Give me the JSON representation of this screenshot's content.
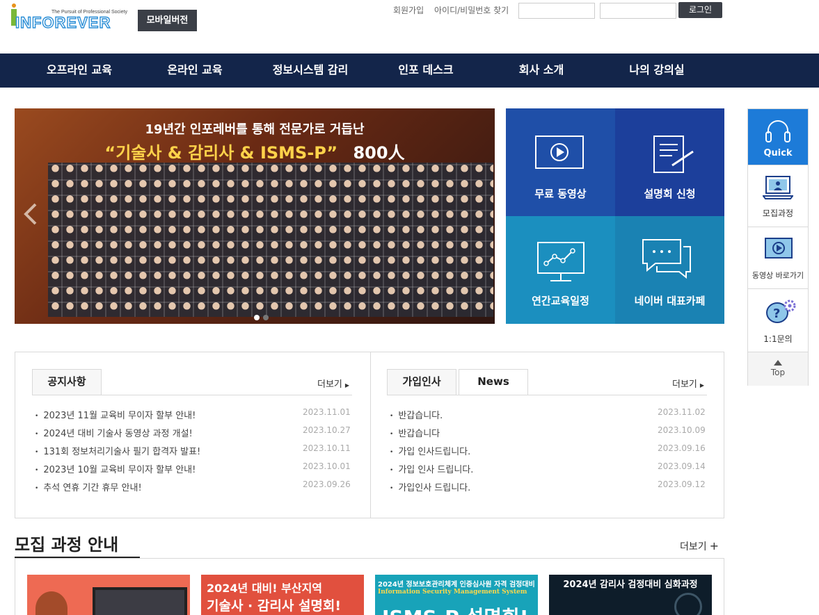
{
  "header": {
    "logo_tagline": "The Pursuit of Professional Society",
    "logo_word": "INFOREVER",
    "mobile_label": "모바일버전",
    "signup_label": "회원가입",
    "find_label": "아이디/비밀번호 찾기",
    "login_label": "로그인"
  },
  "nav": {
    "items": [
      "오프라인 교육",
      "온라인 교육",
      "정보시스템 감리",
      "인포 데스크",
      "회사 소개",
      "나의 강의실"
    ]
  },
  "hero": {
    "line1": "19년간 인포레버를 통해 전문가로 거듭난",
    "line2_quote": "“기술사 & 감리사 & ISMS-P”",
    "line2_count": "800人",
    "prev_icon": "chevron-left-icon"
  },
  "tiles": {
    "free_video": "무료 동영상",
    "seminar": "설명회 신청",
    "schedule": "연간교육일정",
    "naver_cafe": "네이버 대표카페"
  },
  "quick": {
    "title": "Quick",
    "courses": "모집과정",
    "video": "동영상 바로가기",
    "inquiry": "1:1문의",
    "top": "Top"
  },
  "notice": {
    "tab": "공지사항",
    "more": "더보기",
    "posts": [
      {
        "title": "2023년 11월 교육비 무이자 할부 안내!",
        "date": "2023.11.01"
      },
      {
        "title": "2024년 대비 기술사 동영상 과정 개설!",
        "date": "2023.10.27"
      },
      {
        "title": "131회 정보처리기술사 필기 합격자 발표!",
        "date": "2023.10.11"
      },
      {
        "title": "2023년 10월 교육비 무이자 할부 안내!",
        "date": "2023.10.01"
      },
      {
        "title": "추석 연휴 기간 휴무 안내!",
        "date": "2023.09.26"
      }
    ]
  },
  "greetings": {
    "tab1": "가입인사",
    "tab2": "News",
    "more": "더보기",
    "posts": [
      {
        "title": "반갑습니다.",
        "date": "2023.11.02"
      },
      {
        "title": "반갑습니다",
        "date": "2023.10.09"
      },
      {
        "title": "가입 인사드립니다.",
        "date": "2023.09.16"
      },
      {
        "title": "가입 인사 드립니다.",
        "date": "2023.09.14"
      },
      {
        "title": "가입인사 드립니다.",
        "date": "2023.09.12"
      }
    ]
  },
  "recruit": {
    "title": "모집 과정 안내",
    "more": "더보기",
    "cards": [
      {
        "headline": ""
      },
      {
        "headline": "2024년 대비! 부산지역",
        "sub": "기술사 · 감리사 설명회!"
      },
      {
        "headline": "2024년  정보보호관리체계 인증심사원 자격 검정대비",
        "sub": "Information Security Management System",
        "big": "ISMS-P 설명회!"
      },
      {
        "headline": "2024년 감리사 검정대비 심화과정"
      }
    ]
  },
  "colors": {
    "nav_bg": "#13254a",
    "tile_blue": "#1f4fa8",
    "tile_teal": "#1b8fbf",
    "quick_blue": "#1d7bd8"
  }
}
